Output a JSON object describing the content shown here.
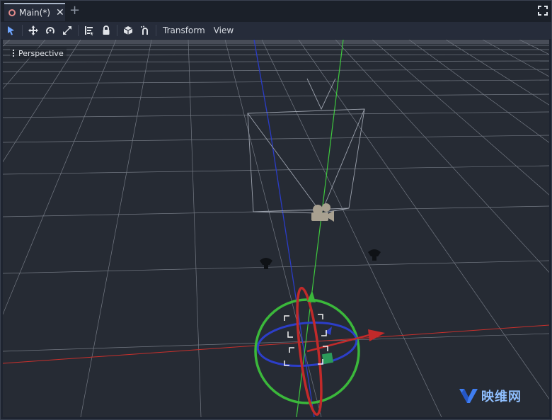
{
  "tabs": [
    {
      "label": "Main(*)",
      "icon": "scene-icon"
    }
  ],
  "toolbar": {
    "tools": [
      "select-icon",
      "move-icon",
      "rotate-icon",
      "scale-icon",
      "list-select-icon",
      "lock-icon",
      "group-icon",
      "snap-icon"
    ],
    "menus": [
      "Transform",
      "View"
    ]
  },
  "viewport": {
    "label": "Perspective"
  },
  "colors": {
    "x_axis": "#c9302c",
    "y_axis": "#3ec93e",
    "z_axis": "#2a3cc8",
    "grid": "#9aa0ab",
    "background": "#262b34"
  },
  "watermark": {
    "text": "映维网"
  }
}
